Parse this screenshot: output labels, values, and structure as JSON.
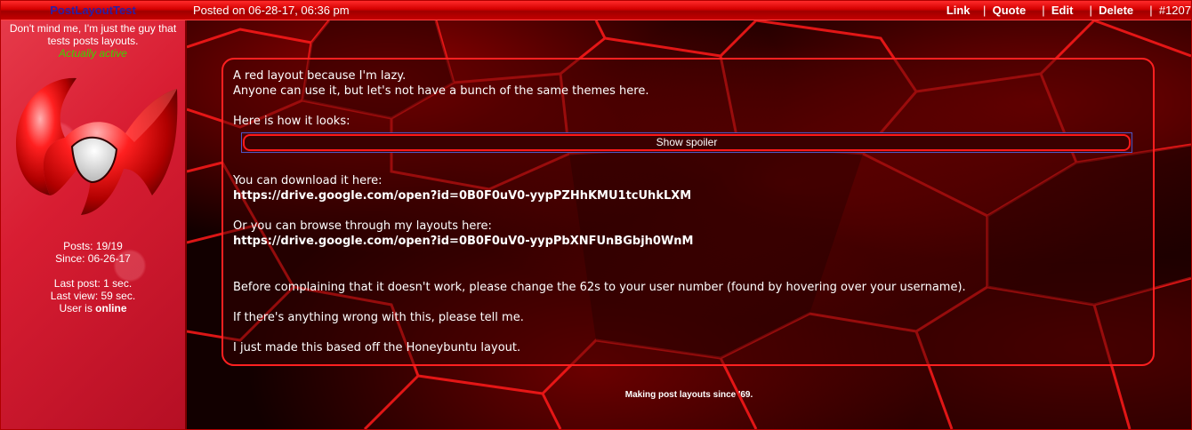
{
  "header": {
    "username": "PostLayoutTest",
    "posted_on": "Posted on 06-28-17, 06:36 pm",
    "actions": [
      "Link",
      "Quote",
      "Edit",
      "Delete"
    ],
    "post_number": "#1207"
  },
  "sidebar": {
    "tagline": "Don't mind me, I'm just the guy that tests posts layouts.",
    "status_text": "Actually active",
    "posts": "Posts: 19/19",
    "since": "Since: 06-26-17",
    "last_post": "Last post: 1 sec.",
    "last_view": "Last view: 59 sec.",
    "user_is": "User is ",
    "online": "online",
    "avatar_icon": "red-m-logo-icon"
  },
  "post": {
    "line1": "A red layout because I'm lazy.",
    "line2": "Anyone can use it, but let's not have a bunch of the same themes here.",
    "line3": "Here is how it looks:",
    "spoiler_label": "Show spoiler",
    "line4": "You can download it here:",
    "link1": "https://drive.google.com/open?id=0B0F0uV0-yypPZHhKMU1tcUhkLXM",
    "line5": "Or you can browse through my layouts here:",
    "link2": "https://drive.google.com/open?id=0B0F0uV0-yypPbXNFUnBGbjh0WnM",
    "line6": "Before complaining that it doesn't work, please change the 62s to your user number (found by hovering over your username).",
    "line7": "If there's anything wrong with this, please tell me.",
    "line8": "I just made this based off the Honeybuntu layout."
  },
  "footer": "Making post layouts since '69.",
  "colors": {
    "accent": "#ff2020",
    "username": "#2a1fa8",
    "status": "#3bd400"
  }
}
